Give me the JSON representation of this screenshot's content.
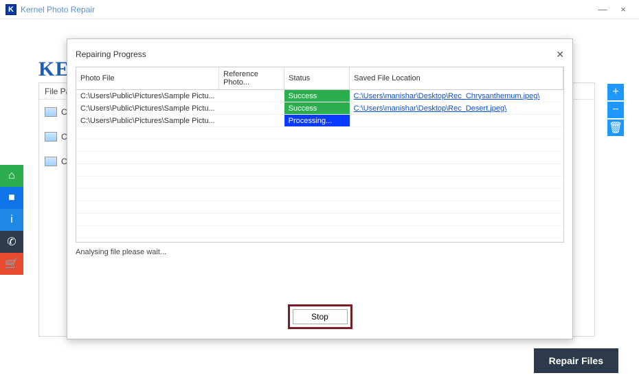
{
  "app": {
    "title": "Kernel Photo Repair",
    "logo_text": "KE"
  },
  "window_controls": {
    "minimize": "—",
    "close": "×"
  },
  "content": {
    "header": "File Pa",
    "files": [
      "C:\\",
      "C:\\",
      "C:\\"
    ]
  },
  "left_toolbar": {
    "home": "⌂",
    "camera": "■",
    "info": "i",
    "phone": "✆",
    "cart": "🛒"
  },
  "right_toolbar": {
    "add": "+",
    "remove": "−",
    "delete": "🗑"
  },
  "bottom": {
    "repair_label": "Repair Files"
  },
  "modal": {
    "title": "Repairing Progress",
    "columns": {
      "photo": "Photo File",
      "ref": "Reference Photo...",
      "status": "Status",
      "saved": "Saved File Location"
    },
    "rows": [
      {
        "photo": "C:\\Users\\Public\\Pictures\\Sample Pictu...",
        "ref": "",
        "status": "Success",
        "status_class": "success",
        "saved": "C:\\Users\\manishar\\Desktop\\Rec_Chrysanthemum.jpeg\\"
      },
      {
        "photo": "C:\\Users\\Public\\Pictures\\Sample Pictu...",
        "ref": "",
        "status": "Success",
        "status_class": "success",
        "saved": "C:\\Users\\manishar\\Desktop\\Rec_Desert.jpeg\\"
      },
      {
        "photo": "C:\\Users\\Public\\Pictures\\Sample Pictu...",
        "ref": "",
        "status": "Processing...",
        "status_class": "processing",
        "saved": ""
      }
    ],
    "status_text": "Analysing file please wait...",
    "stop_label": "Stop"
  }
}
